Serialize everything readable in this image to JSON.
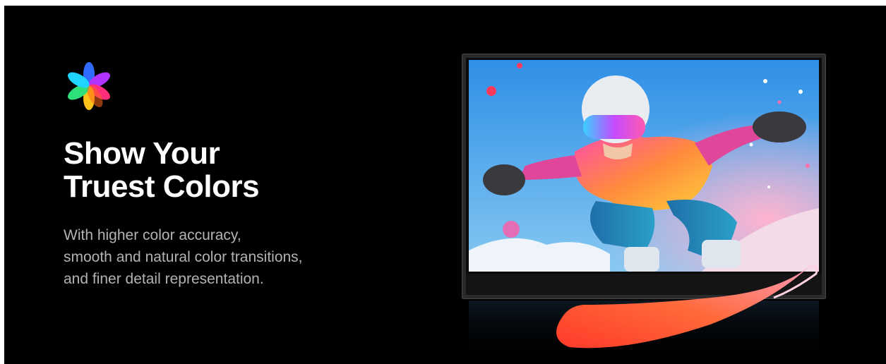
{
  "hero": {
    "icon": "flower-color-icon",
    "headline": [
      "Show Your",
      "Truest Colors"
    ],
    "body_lines": [
      "With higher color accuracy,",
      "smooth and natural color transitions,",
      "and finer detail representation."
    ]
  },
  "product_image": {
    "subject": "portable-monitor-snowboarder-image"
  },
  "colors": {
    "background": "#000000",
    "headline": "#ffffff",
    "body": "#b3b3b3"
  }
}
